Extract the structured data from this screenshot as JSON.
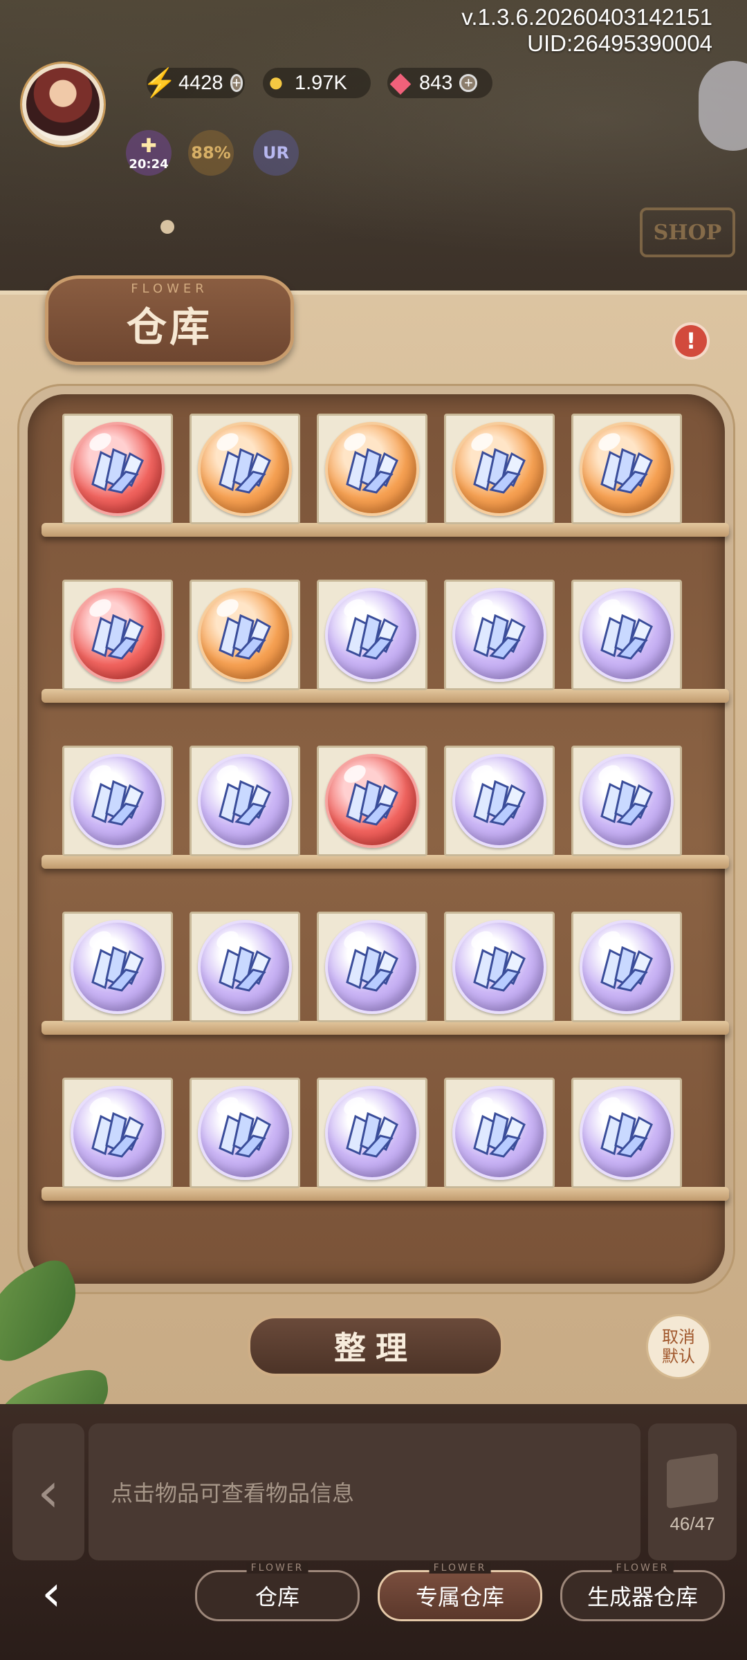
{
  "header": {
    "version": "v.1.3.6.20260403142151",
    "uid": "UID:26495390004"
  },
  "resources": {
    "energy": "4428",
    "coins": "1.97K",
    "gems": "843"
  },
  "buffs": {
    "timer": "20:24",
    "percent": "88%",
    "badge": "UR"
  },
  "shop_sign": "SHOP",
  "warehouse": {
    "flower_caption": "FLOWER",
    "title": "仓库",
    "alert": "!",
    "rows": [
      [
        "red",
        "orange",
        "orange",
        "orange",
        "orange"
      ],
      [
        "red",
        "orange",
        "purple",
        "purple",
        "purple"
      ],
      [
        "purple",
        "purple",
        "red",
        "purple",
        "purple"
      ],
      [
        "purple",
        "purple",
        "purple",
        "purple",
        "purple"
      ],
      [
        "purple",
        "purple",
        "purple",
        "purple",
        "purple"
      ]
    ],
    "item_icon": "energy-crystal-orb-icon"
  },
  "actions": {
    "sort_label": "整理",
    "cancel_default_label": "取消默认"
  },
  "info": {
    "hint": "点击物品可查看物品信息",
    "capacity": "46/47"
  },
  "tabs": [
    {
      "label": "仓库",
      "deco": "FLOWER",
      "active": false
    },
    {
      "label": "专属仓库",
      "deco": "FLOWER",
      "active": true
    },
    {
      "label": "生成器仓库",
      "deco": "FLOWER",
      "active": false
    }
  ]
}
